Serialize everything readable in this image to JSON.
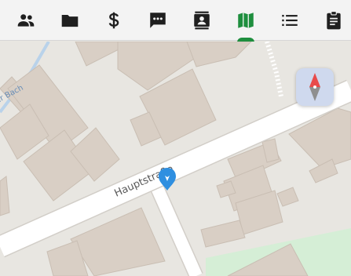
{
  "colors": {
    "toolbar_bg": "#f3f3f3",
    "icon": "#1f1f1f",
    "active_icon": "#1e8e3e",
    "map_bg": "#e8e6e1",
    "building_fill": "#d9cfc5",
    "building_stroke": "#c9beb3",
    "road": "#ffffff",
    "road_edge": "#d2cec8",
    "park": "#d5eed6",
    "marker": "#2f8fe0",
    "compass_bg": "#cfd9ee",
    "compass_north": "#e84b4b",
    "compass_south": "#8f8f8f"
  },
  "toolbar": {
    "tabs": [
      {
        "id": "people",
        "icon": "people-icon",
        "active": false
      },
      {
        "id": "files",
        "icon": "folder-icon",
        "active": false
      },
      {
        "id": "money",
        "icon": "dollar-icon",
        "active": false
      },
      {
        "id": "chat",
        "icon": "chat-icon",
        "active": false
      },
      {
        "id": "contacts",
        "icon": "contact-card-icon",
        "active": false
      },
      {
        "id": "map",
        "icon": "map-icon",
        "active": true
      },
      {
        "id": "list",
        "icon": "list-icon",
        "active": false
      },
      {
        "id": "clipboard",
        "icon": "clipboard-icon",
        "active": false
      }
    ]
  },
  "map": {
    "street_labels": {
      "main": "Hauptstraße",
      "partial": "ler Bach"
    },
    "marker": {
      "icon": "location-pin-icon"
    },
    "compass": {
      "icon": "compass-icon"
    }
  }
}
